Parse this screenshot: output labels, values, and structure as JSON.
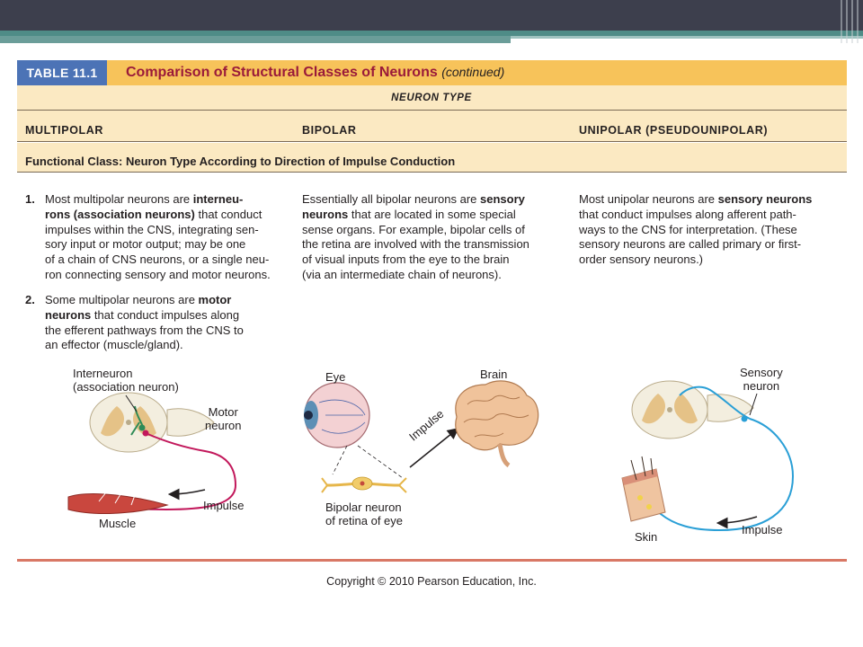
{
  "table": {
    "number": "TABLE 11.1",
    "title": "Comparison of Structural Classes of Neurons",
    "title_suffix": "(continued)",
    "neuron_type_header": "NEURON TYPE",
    "columns": [
      "MULTIPOLAR",
      "BIPOLAR",
      "UNIPOLAR (PSEUDOUNIPOLAR)"
    ],
    "functional_class": "Functional Class: Neuron Type According to Direction of Impulse Conduction"
  },
  "multipolar": {
    "item1_num": "1.",
    "item1": {
      "l1a": "Most multipolar neurons are ",
      "l1b": "interneu-",
      "l2a": "rons (association neurons)",
      "l2b": " that conduct",
      "l3": "impulses within the CNS, integrating sen-",
      "l4": "sory input or motor output; may be one",
      "l5": "of a chain of CNS neurons, or a single neu-",
      "l6": "ron connecting sensory and motor neurons."
    },
    "item2_num": "2.",
    "item2": {
      "l1a": "Some multipolar neurons are ",
      "l1b": "motor",
      "l2a": "neurons",
      "l2b": " that conduct impulses along",
      "l3": "the efferent pathways from the CNS to",
      "l4": "an effector (muscle/gland)."
    }
  },
  "bipolar": {
    "l1a": "Essentially all bipolar neurons are ",
    "l1b": "sensory",
    "l2a": "neurons",
    "l2b": " that are located in some special",
    "l3": "sense organs. For example, bipolar cells of",
    "l4": "the retina are involved with the transmission",
    "l5": "of visual inputs from the eye to the brain",
    "l6": "(via an intermediate chain of neurons)."
  },
  "unipolar": {
    "l1a": "Most unipolar neurons are ",
    "l1b": "sensory neurons",
    "l2": "that conduct impulses along afferent path-",
    "l3": "ways to the CNS for interpretation. (These",
    "l4": "sensory neurons are called primary or first-",
    "l5": "order sensory neurons.)"
  },
  "illustration_labels": {
    "interneuron_1": "Interneuron",
    "interneuron_2": "(association neuron)",
    "motor_1": "Motor",
    "motor_2": "neuron",
    "impulse_multipolar": "Impulse",
    "muscle": "Muscle",
    "eye": "Eye",
    "brain": "Brain",
    "impulse_bipolar": "Impulse",
    "bipolar_1": "Bipolar neuron",
    "bipolar_2": "of retina of eye",
    "sensory_1": "Sensory",
    "sensory_2": "neuron",
    "skin": "Skin",
    "impulse_unipolar": "Impulse"
  },
  "copyright": "Copyright © 2010 Pearson Education, Inc.",
  "colors": {
    "header_blue": "#4c73b6",
    "header_gold": "#f7c35a",
    "band": "#fbe9c2",
    "title_red": "#9a1a3a",
    "motor_neuron": "#c2185b",
    "sensory_neuron": "#2a9fd6",
    "footer_rule": "#d97865"
  }
}
